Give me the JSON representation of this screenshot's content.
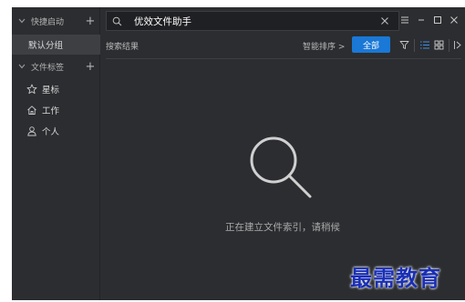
{
  "sidebar": {
    "quick_launch": {
      "label": "快捷启动",
      "add": "+"
    },
    "default_group": "默认分组",
    "file_tags": {
      "label": "文件标签",
      "add": "+"
    },
    "tags": [
      {
        "label": "星标",
        "icon": "star-icon"
      },
      {
        "label": "工作",
        "icon": "home-icon"
      },
      {
        "label": "个人",
        "icon": "person-icon"
      }
    ]
  },
  "search": {
    "value": "优效文件助手"
  },
  "toolbar": {
    "results_label": "搜索结果",
    "sort_label": "智能排序 >",
    "all_button": "全部"
  },
  "empty_state": {
    "message": "正在建立文件索引，请稍候"
  },
  "watermark": "最需教育",
  "colors": {
    "background": "#2b2d30",
    "accent": "#1a78d6",
    "watermark": "#1a2fb5"
  }
}
